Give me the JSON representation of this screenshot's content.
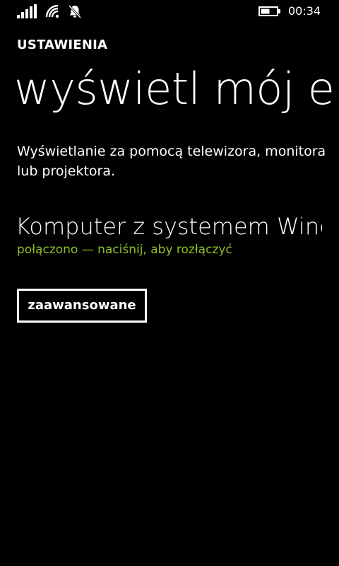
{
  "status_bar": {
    "time": "00:34",
    "icons": [
      "signal-strength-icon",
      "wifi-icon",
      "quiet-hours-icon",
      "battery-icon"
    ]
  },
  "header": {
    "app_title": "USTAWIENIA",
    "page_title": "wyświetl mój ekran"
  },
  "description": "Wyświetlanie za pomocą telewizora, monitora lub projektora.",
  "device": {
    "name": "Komputer z systemem Windows",
    "status": "połączono — naciśnij, aby rozłączyć"
  },
  "advanced_button": {
    "label": "zaawansowane"
  },
  "colors": {
    "background": "#000000",
    "text": "#ffffff",
    "status_accent": "#8cbf26"
  }
}
